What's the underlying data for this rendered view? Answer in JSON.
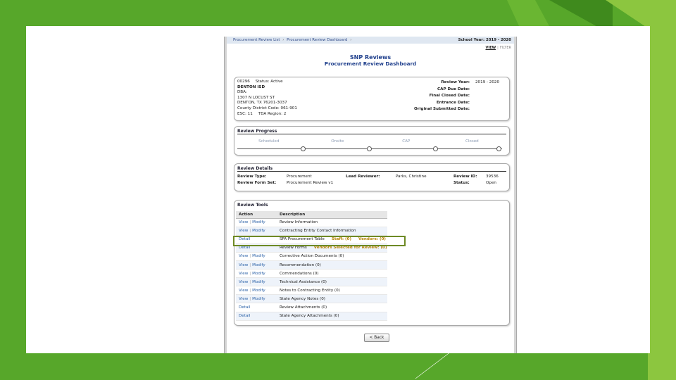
{
  "header": {
    "breadcrumb": [
      "Procurement Review List",
      "Procurement Review Dashboard"
    ],
    "breadcrumb_separator": "›",
    "school_year": "School Year: 2019 - 2020",
    "view_label": "VIEW",
    "filter_label": "FILTER"
  },
  "title": {
    "line1": "SNP Reviews",
    "line2": "Procurement Review Dashboard"
  },
  "entity": {
    "id": "00296",
    "status": "Status: Active",
    "name": "DENTON ISD",
    "dba": "DBA:",
    "street": "1307 N LOCUST ST",
    "city": "DENTON, TX 76201-3037",
    "county_district": "County District Code: 061-901",
    "esc": "ESC: 11",
    "tda_region": "TDA Region: 2",
    "right": [
      {
        "label": "Review Year:",
        "value": "2019 - 2020"
      },
      {
        "label": "CAP Due Date:",
        "value": ""
      },
      {
        "label": "Final Closed Date:",
        "value": ""
      },
      {
        "label": "Entrance Date:",
        "value": ""
      },
      {
        "label": "Original Submitted Date:",
        "value": ""
      }
    ]
  },
  "progress": {
    "title": "Review Progress",
    "steps": [
      "Scheduled",
      "Onsite",
      "CAP",
      "Closed"
    ]
  },
  "details": {
    "title": "Review Details",
    "review_type_label": "Review Type:",
    "review_type": "Procurement",
    "form_set_label": "Review Form Set:",
    "form_set": "Procurement Review v1",
    "lead_reviewer_label": "Lead Reviewer:",
    "lead_reviewer": "Parks, Christine",
    "review_id_label": "Review ID:",
    "review_id": "39536",
    "status_label": "Status:",
    "status": "Open"
  },
  "tools": {
    "title": "Review Tools",
    "columns": [
      "Action",
      "Description"
    ],
    "rows": [
      {
        "actions": [
          "View",
          "Modify"
        ],
        "description": "Review Information",
        "extra": []
      },
      {
        "actions": [
          "View",
          "Modify"
        ],
        "description": "Contracting Entity Contact Information",
        "extra": []
      },
      {
        "actions": [
          "Detail"
        ],
        "description": "SFA Procurement Table",
        "extra": [
          "Staff: (0)",
          "Vendors: (0)"
        ]
      },
      {
        "actions": [
          "Detail"
        ],
        "description": "Review Forms",
        "extra": [
          "Vendors Selected for Review: (0)"
        ]
      },
      {
        "actions": [
          "View",
          "Modify"
        ],
        "description": "Corrective Action Documents (0)",
        "extra": []
      },
      {
        "actions": [
          "View",
          "Modify"
        ],
        "description": "Recommendation (0)",
        "extra": []
      },
      {
        "actions": [
          "View",
          "Modify"
        ],
        "description": "Commendations (0)",
        "extra": []
      },
      {
        "actions": [
          "View",
          "Modify"
        ],
        "description": "Technical Assistance (0)",
        "extra": []
      },
      {
        "actions": [
          "View",
          "Modify"
        ],
        "description": "Notes to Contracting Entity (0)",
        "extra": []
      },
      {
        "actions": [
          "View",
          "Modify"
        ],
        "description": "State Agency Notes (0)",
        "extra": []
      },
      {
        "actions": [
          "Detail"
        ],
        "description": "Review Attachments (0)",
        "extra": []
      },
      {
        "actions": [
          "Detail"
        ],
        "description": "State Agency Attachments (0)",
        "extra": []
      }
    ]
  },
  "back_button": "< Back",
  "colors": {
    "background_green": "#57a72a",
    "light_green": "#8cc63f",
    "link_blue": "#2c62a8",
    "title_blue": "#1f3f8c",
    "highlight_orange": "#b8860b",
    "highlight_box": "#6e8a25"
  }
}
